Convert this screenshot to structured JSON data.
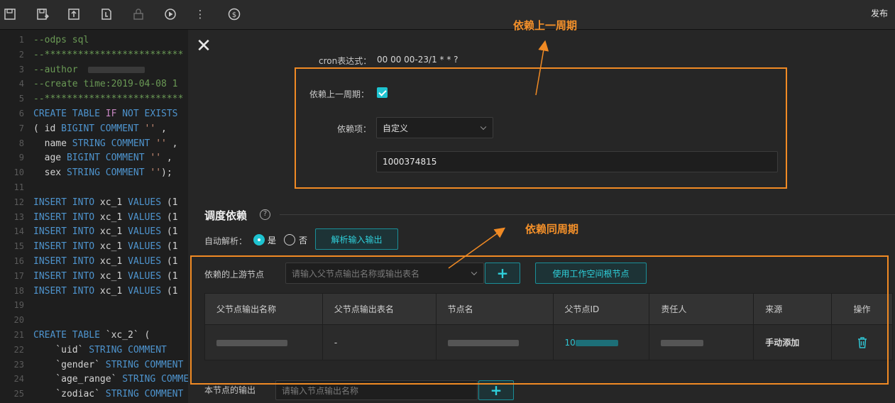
{
  "toolbar": {
    "icons": [
      "save-icon",
      "save-as-icon",
      "submit-icon",
      "steal-lock-icon",
      "lock-icon",
      "run-icon",
      "more-icon",
      "cost-icon"
    ],
    "cost_glyph": "$",
    "more_glyph": "⋮",
    "publish_label": "发布"
  },
  "editor": {
    "lines": [
      {
        "n": "1",
        "tokens": [
          {
            "t": "--odps sql",
            "c": "cm"
          }
        ]
      },
      {
        "n": "2",
        "tokens": [
          {
            "t": "--*************************",
            "c": "cm"
          }
        ]
      },
      {
        "n": "3",
        "tokens": [
          {
            "t": "--author",
            "c": "cm"
          }
        ]
      },
      {
        "n": "4",
        "tokens": [
          {
            "t": "--create time:2019-04-08 1",
            "c": "cm"
          }
        ]
      },
      {
        "n": "5",
        "tokens": [
          {
            "t": "--*************************",
            "c": "cm"
          }
        ]
      },
      {
        "n": "6",
        "tokens": [
          {
            "t": "CREATE TABLE ",
            "c": "kw"
          },
          {
            "t": "IF",
            "c": "kw2"
          },
          {
            "t": " NOT EXISTS",
            "c": "kw"
          }
        ]
      },
      {
        "n": "7",
        "tokens": [
          {
            "t": "( id ",
            "c": "tx"
          },
          {
            "t": "BIGINT COMMENT",
            "c": "kw"
          },
          {
            "t": " ''",
            "c": "str"
          },
          {
            "t": " ,",
            "c": "tx"
          }
        ]
      },
      {
        "n": "8",
        "tokens": [
          {
            "t": "  name ",
            "c": "tx"
          },
          {
            "t": "STRING COMMENT",
            "c": "kw"
          },
          {
            "t": " ''",
            "c": "str"
          },
          {
            "t": " ,",
            "c": "tx"
          }
        ]
      },
      {
        "n": "9",
        "tokens": [
          {
            "t": "  age ",
            "c": "tx"
          },
          {
            "t": "BIGINT COMMENT",
            "c": "kw"
          },
          {
            "t": " ''",
            "c": "str"
          },
          {
            "t": " ,",
            "c": "tx"
          }
        ]
      },
      {
        "n": "10",
        "tokens": [
          {
            "t": "  sex ",
            "c": "tx"
          },
          {
            "t": "STRING COMMENT",
            "c": "kw"
          },
          {
            "t": " ''",
            "c": "str"
          },
          {
            "t": ");",
            "c": "tx"
          }
        ]
      },
      {
        "n": "11",
        "tokens": []
      },
      {
        "n": "12",
        "tokens": [
          {
            "t": "INSERT INTO",
            "c": "kw"
          },
          {
            "t": " xc_1 ",
            "c": "tx"
          },
          {
            "t": "VALUES",
            "c": "kw"
          },
          {
            "t": " (1",
            "c": "tx"
          }
        ]
      },
      {
        "n": "13",
        "tokens": [
          {
            "t": "INSERT INTO",
            "c": "kw"
          },
          {
            "t": " xc_1 ",
            "c": "tx"
          },
          {
            "t": "VALUES",
            "c": "kw"
          },
          {
            "t": " (1",
            "c": "tx"
          }
        ]
      },
      {
        "n": "14",
        "tokens": [
          {
            "t": "INSERT INTO",
            "c": "kw"
          },
          {
            "t": " xc_1 ",
            "c": "tx"
          },
          {
            "t": "VALUES",
            "c": "kw"
          },
          {
            "t": " (1",
            "c": "tx"
          }
        ]
      },
      {
        "n": "15",
        "tokens": [
          {
            "t": "INSERT INTO",
            "c": "kw"
          },
          {
            "t": " xc_1 ",
            "c": "tx"
          },
          {
            "t": "VALUES",
            "c": "kw"
          },
          {
            "t": " (1",
            "c": "tx"
          }
        ]
      },
      {
        "n": "16",
        "tokens": [
          {
            "t": "INSERT INTO",
            "c": "kw"
          },
          {
            "t": " xc_1 ",
            "c": "tx"
          },
          {
            "t": "VALUES",
            "c": "kw"
          },
          {
            "t": " (1",
            "c": "tx"
          }
        ]
      },
      {
        "n": "17",
        "tokens": [
          {
            "t": "INSERT INTO",
            "c": "kw"
          },
          {
            "t": " xc_1 ",
            "c": "tx"
          },
          {
            "t": "VALUES",
            "c": "kw"
          },
          {
            "t": " (1",
            "c": "tx"
          }
        ]
      },
      {
        "n": "18",
        "tokens": [
          {
            "t": "INSERT INTO",
            "c": "kw"
          },
          {
            "t": " xc_1 ",
            "c": "tx"
          },
          {
            "t": "VALUES",
            "c": "kw"
          },
          {
            "t": " (1",
            "c": "tx"
          }
        ]
      },
      {
        "n": "19",
        "tokens": []
      },
      {
        "n": "20",
        "tokens": []
      },
      {
        "n": "21",
        "tokens": [
          {
            "t": "CREATE TABLE",
            "c": "kw"
          },
          {
            "t": " `xc_2` (",
            "c": "tx"
          }
        ]
      },
      {
        "n": "22",
        "tokens": [
          {
            "t": "    `uid` ",
            "c": "tx"
          },
          {
            "t": "STRING COMMENT",
            "c": "kw"
          }
        ]
      },
      {
        "n": "23",
        "tokens": [
          {
            "t": "    `gender` ",
            "c": "tx"
          },
          {
            "t": "STRING COMMENT",
            "c": "kw"
          }
        ]
      },
      {
        "n": "24",
        "tokens": [
          {
            "t": "    `age_range` ",
            "c": "tx"
          },
          {
            "t": "STRING COMMENT",
            "c": "kw"
          }
        ]
      },
      {
        "n": "25",
        "tokens": [
          {
            "t": "    `zodiac` ",
            "c": "tx"
          },
          {
            "t": "STRING COMMENT",
            "c": "kw"
          }
        ]
      }
    ]
  },
  "panel": {
    "close_glyph": "✕",
    "cron_label": "cron表达式：",
    "cron_value": "00 00 00-23/1 * * ?",
    "depend_prev_label": "依赖上一周期：",
    "depend_prev_checked": true,
    "depend_item_label": "依赖项：",
    "depend_item_value": "自定义",
    "custom_id_value": "1000374815",
    "schedule_title": "调度依赖",
    "help_glyph": "?",
    "auto_parse_label": "自动解析：",
    "auto_parse_yes": "是",
    "auto_parse_no": "否",
    "auto_parse_selected": "是",
    "parse_button": "解析输入输出",
    "upstream_label": "依赖的上游节点",
    "upstream_placeholder": "请输入父节点输出名称或输出表名",
    "plus_glyph": "+",
    "root_node_button": "使用工作空间根节点",
    "table": {
      "headers": [
        "父节点输出名称",
        "父节点输出表名",
        "节点名",
        "父节点ID",
        "责任人",
        "来源",
        "操作"
      ],
      "rows": [
        {
          "output_table": "-",
          "parent_id_prefix": "10",
          "source": "手动添加",
          "action_icon": "trash-icon"
        }
      ]
    },
    "output_label": "本节点的输出",
    "output_placeholder": "请输入节点输出名称"
  },
  "annotations": {
    "prev_cycle": "依赖上一周期",
    "same_cycle": "依赖同周期",
    "color": "#f08a24"
  },
  "colors": {
    "accent": "#1ec3d0",
    "panel_bg": "#262626",
    "toolbar_bg": "#2b2b2b"
  }
}
